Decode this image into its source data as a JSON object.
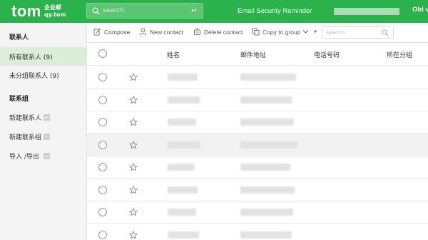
{
  "header": {
    "logo_main": "tom",
    "logo_sub_line1": "企业邮",
    "logo_sub_line2": "qy.tom",
    "search_placeholder": "search",
    "reminder": "Email Security Reminder",
    "user_partial": "Old v"
  },
  "sidebar": {
    "section_contacts": "联系人",
    "items_contacts": [
      {
        "label": "所有联系人 (9)",
        "active": true
      },
      {
        "label": "未分组联系人 (9)",
        "active": false
      }
    ],
    "section_groups": "联系组",
    "items_groups": [
      {
        "label": "新建联系人"
      },
      {
        "label": "新建联系组"
      },
      {
        "label": "导入 /导出"
      }
    ]
  },
  "toolbar": {
    "compose": "Compose",
    "new_contact": "New contact",
    "delete_contact": "Delete contact",
    "copy_to_group": "Copy to group",
    "search_placeholder": "search"
  },
  "table": {
    "columns": [
      "姓名",
      "邮件地址",
      "电话号码",
      "所在分组"
    ],
    "row_count": 8,
    "highlighted_row": 3
  },
  "colors": {
    "brand_green": "#2bb24c",
    "sidebar_bg": "#f4f4f4",
    "active_bg": "#dceed9",
    "row_highlight": "#f2f2f2"
  },
  "icons": [
    "search-icon",
    "enter-icon",
    "compose-icon",
    "user-icon",
    "delete-icon",
    "copy-icon",
    "chevron-down-icon",
    "star-icon"
  ]
}
